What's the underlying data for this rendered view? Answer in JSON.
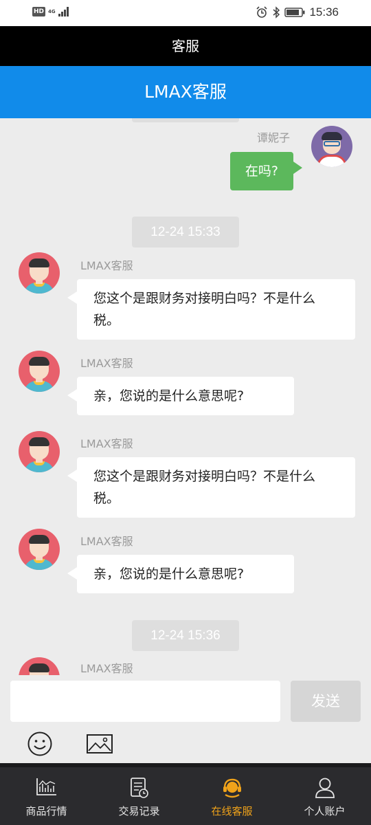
{
  "status_bar": {
    "hd_badge": "HD",
    "network": "4G",
    "time": "15:36"
  },
  "title_bar": {
    "title": "客服"
  },
  "header": {
    "title": "LMAX客服"
  },
  "chat": {
    "user_message": {
      "sender": "谭妮子",
      "text": "在吗?"
    },
    "timestamps": [
      "12-24 15:33",
      "12-24 15:36"
    ],
    "agent_messages": [
      {
        "sender": "LMAX客服",
        "text": "您这个是跟财务对接明白吗？不是什么税。"
      },
      {
        "sender": "LMAX客服",
        "text": "亲，您说的是什么意思呢?"
      },
      {
        "sender": "LMAX客服",
        "text": "您这个是跟财务对接明白吗？不是什么税。"
      },
      {
        "sender": "LMAX客服",
        "text": "亲，您说的是什么意思呢?"
      },
      {
        "sender": "LMAX客服",
        "text": ""
      }
    ]
  },
  "input": {
    "value": "",
    "placeholder": "",
    "send_label": "发送"
  },
  "bottom_nav": {
    "items": [
      {
        "label": "商品行情",
        "icon": "market-chart-icon"
      },
      {
        "label": "交易记录",
        "icon": "trade-record-icon"
      },
      {
        "label": "在线客服",
        "icon": "customer-service-icon"
      },
      {
        "label": "个人账户",
        "icon": "person-icon"
      }
    ],
    "active_index": 2,
    "active_color": "#f0a31a"
  },
  "colors": {
    "header_blue": "#118bea",
    "user_bubble_green": "#5cb85c",
    "agent_avatar": "#e8606c",
    "user_avatar": "#7e6aa8"
  }
}
